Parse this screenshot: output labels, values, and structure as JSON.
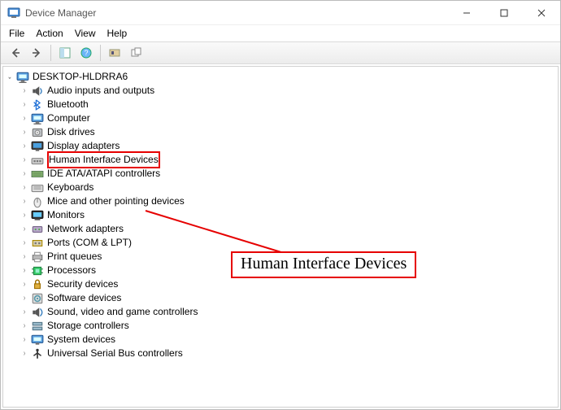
{
  "window": {
    "title": "Device Manager"
  },
  "menu": [
    "File",
    "Action",
    "View",
    "Help"
  ],
  "tree": {
    "root": {
      "label": "DESKTOP-HLDRRA6",
      "expander": "⌄"
    },
    "items": [
      {
        "label": "Audio inputs and outputs",
        "icon": "audio"
      },
      {
        "label": "Bluetooth",
        "icon": "bluetooth"
      },
      {
        "label": "Computer",
        "icon": "computer"
      },
      {
        "label": "Disk drives",
        "icon": "disk"
      },
      {
        "label": "Display adapters",
        "icon": "display"
      },
      {
        "label": "Human Interface Devices",
        "icon": "hid",
        "highlight": true
      },
      {
        "label": "IDE ATA/ATAPI controllers",
        "icon": "ide"
      },
      {
        "label": "Keyboards",
        "icon": "keyboard"
      },
      {
        "label": "Mice and other pointing devices",
        "icon": "mouse"
      },
      {
        "label": "Monitors",
        "icon": "monitor"
      },
      {
        "label": "Network adapters",
        "icon": "network"
      },
      {
        "label": "Ports (COM & LPT)",
        "icon": "ports"
      },
      {
        "label": "Print queues",
        "icon": "printer"
      },
      {
        "label": "Processors",
        "icon": "cpu"
      },
      {
        "label": "Security devices",
        "icon": "security"
      },
      {
        "label": "Software devices",
        "icon": "software"
      },
      {
        "label": "Sound, video and game controllers",
        "icon": "sound"
      },
      {
        "label": "Storage controllers",
        "icon": "storage"
      },
      {
        "label": "System devices",
        "icon": "system"
      },
      {
        "label": "Universal Serial Bus controllers",
        "icon": "usb"
      }
    ]
  },
  "callout": "Human Interface Devices"
}
